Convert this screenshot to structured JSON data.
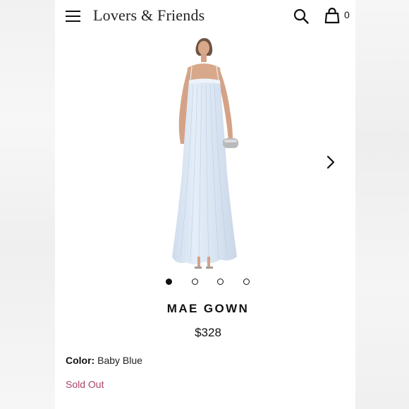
{
  "header": {
    "brand": "Lovers & Friends",
    "cart_count": "0",
    "icons": {
      "menu": "hamburger-menu-icon",
      "search": "search-icon",
      "cart": "shopping-bag-icon"
    }
  },
  "gallery": {
    "image": "pale blue pleated strapless maxi gown on model",
    "slide_count": 4,
    "active_index": 0,
    "next_icon": "chevron-right-icon"
  },
  "product": {
    "name": "MAE GOWN",
    "price": "$328",
    "color_label": "Color:",
    "color_value": "Baby Blue",
    "availability": "Sold Out"
  },
  "colors": {
    "gown": "#dfeaf6",
    "sold_out": "#a8416a",
    "text": "#111111"
  }
}
